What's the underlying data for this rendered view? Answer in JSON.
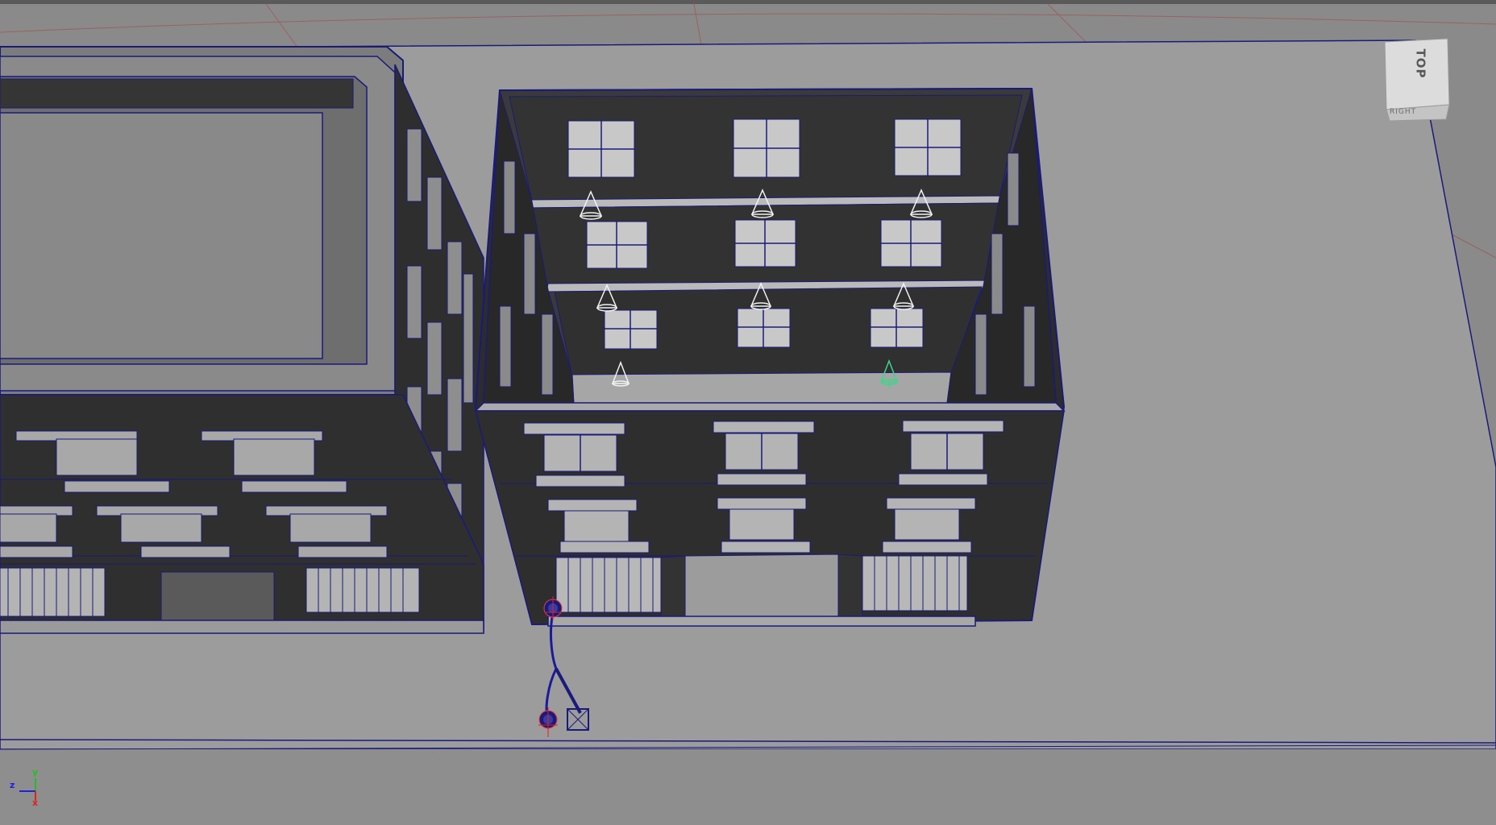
{
  "viewport": {
    "camera_view": "TOP",
    "viewcube": {
      "face_top": "TOP",
      "face_side": "RIGHT"
    },
    "axis_gizmo": {
      "x": "x",
      "y": "y",
      "z": "z"
    }
  },
  "colors": {
    "background": "#8a8a8a",
    "ground": "#9a9a9a",
    "wireframe": "#1a1a7a",
    "interior_dark": "#3a3a3a",
    "light_locator": "#f0f0f0",
    "selected_locator": "#3cd68a",
    "grid_line": "#a04848",
    "axis_x": "#e02020",
    "axis_y": "#20c020",
    "axis_z": "#2020e0"
  },
  "icons": [
    "view-cube-icon",
    "axis-gizmo-icon",
    "spot-light-icon",
    "ik-handle-icon"
  ]
}
